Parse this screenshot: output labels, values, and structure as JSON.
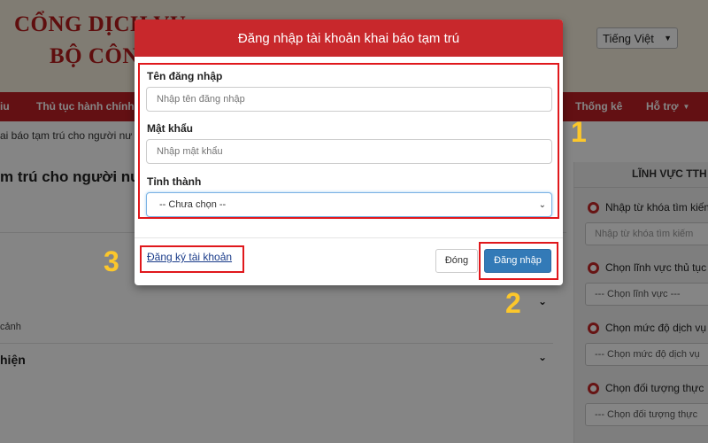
{
  "site": {
    "title_line1": "CỔNG DỊCH VỤ",
    "title_line2": "BỘ CÔNG",
    "language": "Tiếng Việt"
  },
  "nav": {
    "items": [
      {
        "label": "iu"
      },
      {
        "label": "Thủ tục hành chính"
      },
      {
        "label": "Thống kê"
      },
      {
        "label": "Hỗ trợ"
      }
    ]
  },
  "page": {
    "breadcrumb": "ai báo tạm trú cho người nư",
    "heading": "m trú cho người nư",
    "small_text": "cảnh",
    "bold_text": "hiện"
  },
  "sidebar": {
    "title": "LĨNH VỰC TTH",
    "items": [
      {
        "label": "Nhập từ khóa tìm kiếm",
        "field": "Nhập từ khóa tìm kiếm"
      },
      {
        "label": "Chọn lĩnh vực thủ tục",
        "field": "--- Chọn lĩnh vực ---"
      },
      {
        "label": "Chọn mức độ dịch vụ",
        "field": "--- Chọn mức độ dịch vụ"
      },
      {
        "label": "Chọn đối tượng thực",
        "field": "--- Chọn đối tượng thực"
      }
    ]
  },
  "modal": {
    "title": "Đăng nhập tài khoản khai báo tạm trú",
    "username_label": "Tên đăng nhập",
    "username_placeholder": "Nhập tên đăng nhập",
    "password_label": "Mật khẩu",
    "password_placeholder": "Nhập mật khẩu",
    "province_label": "Tỉnh thành",
    "province_selected": "-- Chưa chọn --",
    "register_link": "Đăng ký tài khoản",
    "close_button": "Đóng",
    "login_button": "Đăng nhập"
  },
  "annotations": {
    "step1": "1",
    "step2": "2",
    "step3": "3",
    "box_color": "#e0181c",
    "number_color": "#fcc72b"
  },
  "colors": {
    "brand_red": "#c8282c",
    "primary_blue": "#337ab7"
  }
}
